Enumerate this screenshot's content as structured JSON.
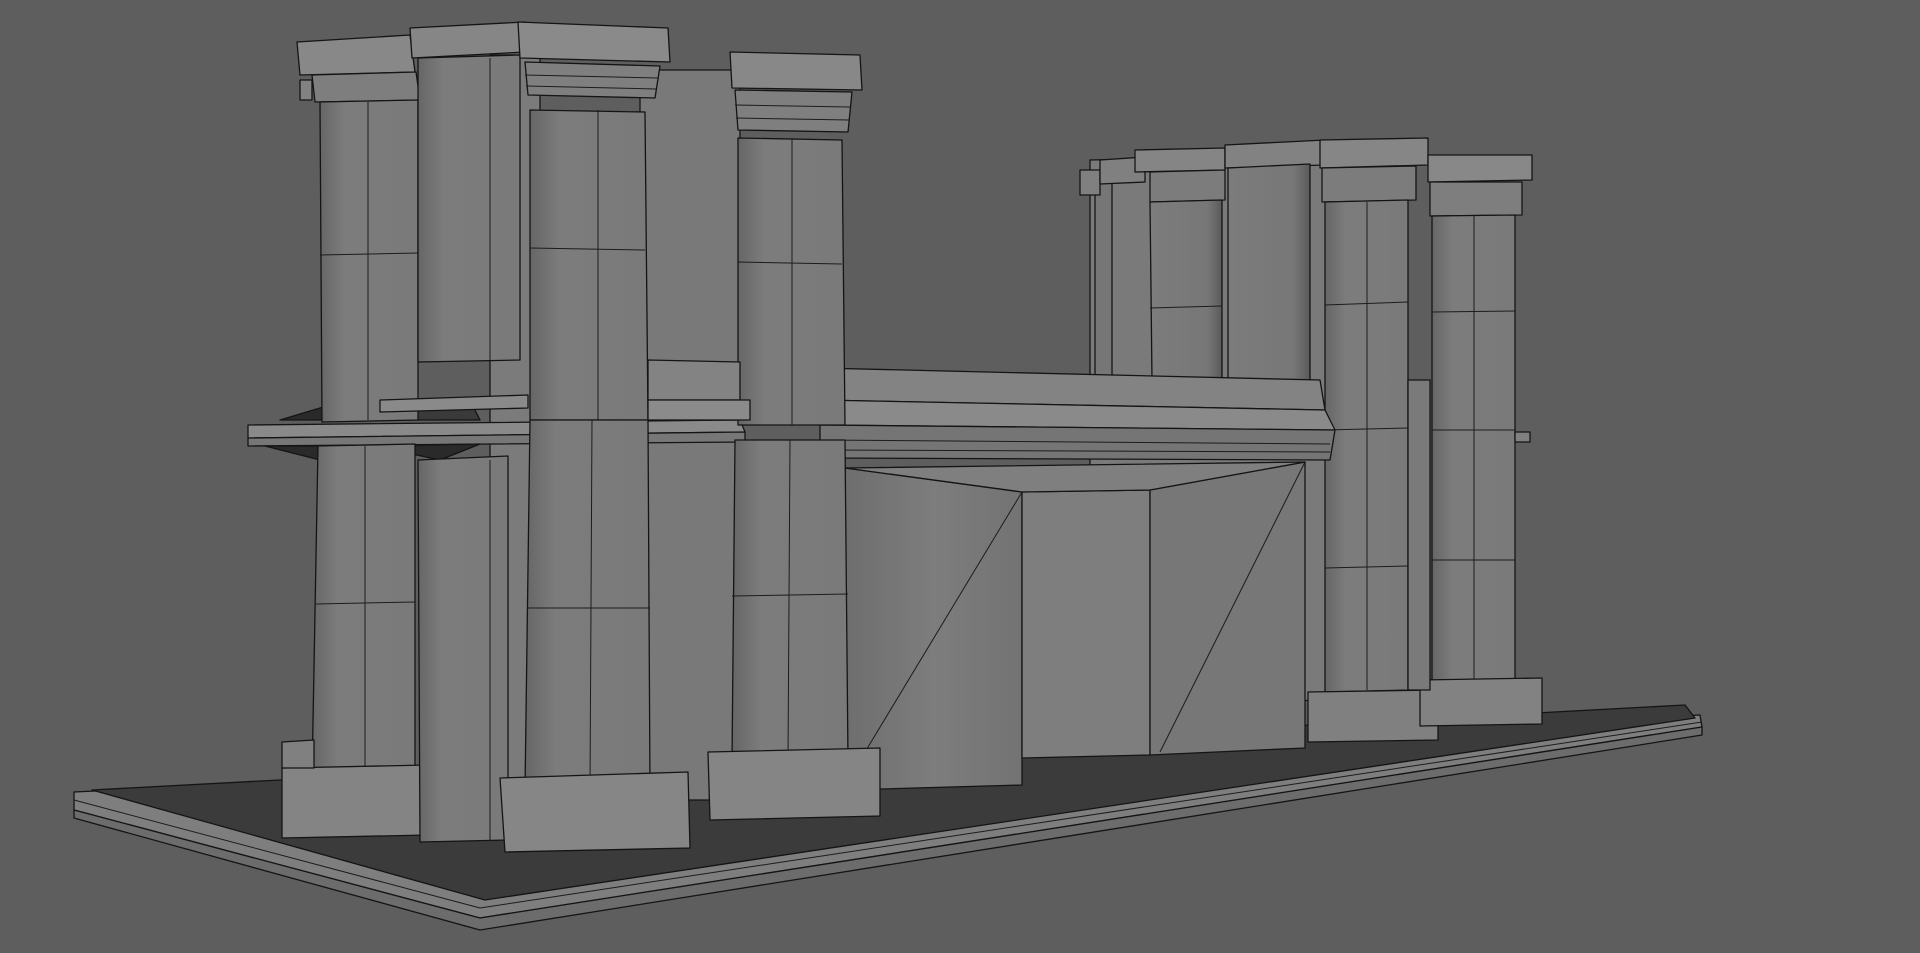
{
  "viewport": {
    "background": "#5e5e5e",
    "model_fill": "#7a7a7a",
    "model_light": "#858585",
    "model_dark": "#6a6a6a",
    "base_top": "#3a3a3a",
    "wire_color": "#141414"
  }
}
